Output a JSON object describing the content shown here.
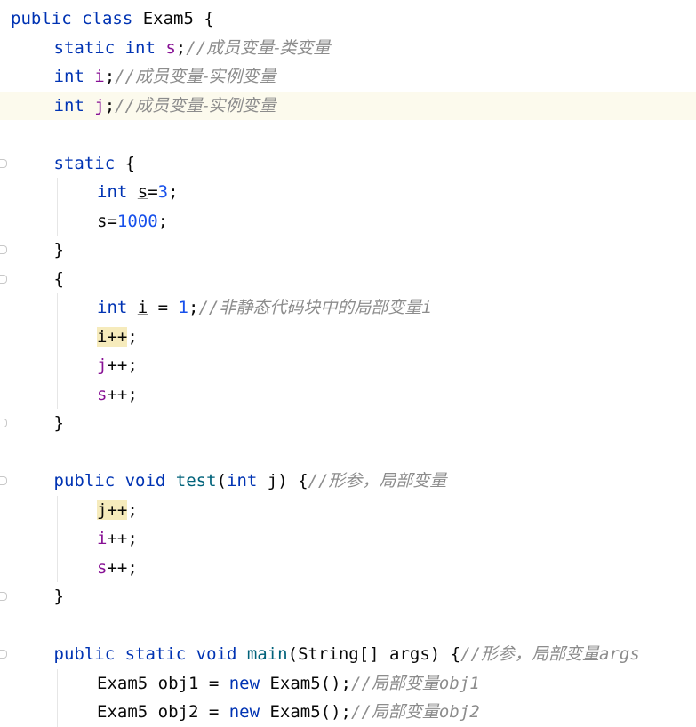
{
  "lines": [
    {
      "indent": 0,
      "tokens": [
        {
          "t": "public ",
          "c": "kw"
        },
        {
          "t": "class ",
          "c": "kw"
        },
        {
          "t": "Exam5 {",
          "c": "plain"
        }
      ]
    },
    {
      "indent": 1,
      "tokens": [
        {
          "t": "static ",
          "c": "kw"
        },
        {
          "t": "int ",
          "c": "kw"
        },
        {
          "t": "s",
          "c": "field"
        },
        {
          "t": ";",
          "c": "plain"
        },
        {
          "t": "//",
          "c": "cm-code"
        },
        {
          "t": "成员变量-类变量",
          "c": "cm"
        }
      ]
    },
    {
      "indent": 1,
      "tokens": [
        {
          "t": "int ",
          "c": "kw"
        },
        {
          "t": "i",
          "c": "field"
        },
        {
          "t": ";",
          "c": "plain"
        },
        {
          "t": "//",
          "c": "cm-code"
        },
        {
          "t": "成员变量-实例变量",
          "c": "cm"
        }
      ]
    },
    {
      "indent": 1,
      "current": true,
      "tokens": [
        {
          "t": "int ",
          "c": "kw"
        },
        {
          "t": "j",
          "c": "field"
        },
        {
          "t": ";",
          "c": "plain"
        },
        {
          "t": "//",
          "c": "cm-code"
        },
        {
          "t": "成员变量-实例变量",
          "c": "cm"
        }
      ]
    },
    {
      "indent": 0,
      "tokens": []
    },
    {
      "indent": 1,
      "tokens": [
        {
          "t": "static ",
          "c": "kw"
        },
        {
          "t": "{",
          "c": "plain"
        }
      ]
    },
    {
      "indent": 2,
      "tokens": [
        {
          "t": "int ",
          "c": "kw"
        },
        {
          "t": "s",
          "c": "plain ul"
        },
        {
          "t": "=",
          "c": "plain"
        },
        {
          "t": "3",
          "c": "num"
        },
        {
          "t": ";",
          "c": "plain"
        }
      ]
    },
    {
      "indent": 2,
      "tokens": [
        {
          "t": "s",
          "c": "plain ul"
        },
        {
          "t": "=",
          "c": "plain"
        },
        {
          "t": "1000",
          "c": "num"
        },
        {
          "t": ";",
          "c": "plain"
        }
      ]
    },
    {
      "indent": 1,
      "tokens": [
        {
          "t": "}",
          "c": "plain"
        }
      ]
    },
    {
      "indent": 1,
      "tokens": [
        {
          "t": "{",
          "c": "plain"
        }
      ]
    },
    {
      "indent": 2,
      "tokens": [
        {
          "t": "int ",
          "c": "kw"
        },
        {
          "t": "i",
          "c": "plain ul"
        },
        {
          "t": " = ",
          "c": "plain"
        },
        {
          "t": "1",
          "c": "num"
        },
        {
          "t": ";",
          "c": "plain"
        },
        {
          "t": "//",
          "c": "cm-code"
        },
        {
          "t": "非静态代码块中的局部变量",
          "c": "cm"
        },
        {
          "t": "i",
          "c": "cm-code"
        }
      ]
    },
    {
      "indent": 2,
      "tokens": [
        {
          "t": "i++",
          "c": "plain hl"
        },
        {
          "t": ";",
          "c": "plain"
        }
      ]
    },
    {
      "indent": 2,
      "tokens": [
        {
          "t": "j",
          "c": "field"
        },
        {
          "t": "++;",
          "c": "plain"
        }
      ]
    },
    {
      "indent": 2,
      "tokens": [
        {
          "t": "s",
          "c": "field"
        },
        {
          "t": "++;",
          "c": "plain"
        }
      ]
    },
    {
      "indent": 1,
      "tokens": [
        {
          "t": "}",
          "c": "plain"
        }
      ]
    },
    {
      "indent": 0,
      "tokens": []
    },
    {
      "indent": 1,
      "tokens": [
        {
          "t": "public ",
          "c": "kw"
        },
        {
          "t": "void ",
          "c": "kw"
        },
        {
          "t": "test",
          "c": "method"
        },
        {
          "t": "(",
          "c": "plain"
        },
        {
          "t": "int ",
          "c": "kw"
        },
        {
          "t": "j) {",
          "c": "plain"
        },
        {
          "t": "//",
          "c": "cm-code"
        },
        {
          "t": "形参，局部变量",
          "c": "cm"
        }
      ]
    },
    {
      "indent": 2,
      "tokens": [
        {
          "t": "j++",
          "c": "plain hl"
        },
        {
          "t": ";",
          "c": "plain"
        }
      ]
    },
    {
      "indent": 2,
      "tokens": [
        {
          "t": "i",
          "c": "field"
        },
        {
          "t": "++;",
          "c": "plain"
        }
      ]
    },
    {
      "indent": 2,
      "tokens": [
        {
          "t": "s",
          "c": "field"
        },
        {
          "t": "++;",
          "c": "plain"
        }
      ]
    },
    {
      "indent": 1,
      "tokens": [
        {
          "t": "}",
          "c": "plain"
        }
      ]
    },
    {
      "indent": 0,
      "tokens": []
    },
    {
      "indent": 1,
      "tokens": [
        {
          "t": "public ",
          "c": "kw"
        },
        {
          "t": "static ",
          "c": "kw"
        },
        {
          "t": "void ",
          "c": "kw"
        },
        {
          "t": "main",
          "c": "method"
        },
        {
          "t": "(String[] args) {",
          "c": "plain"
        },
        {
          "t": "//",
          "c": "cm-code"
        },
        {
          "t": "形参，局部变量",
          "c": "cm"
        },
        {
          "t": "args",
          "c": "cm-code"
        }
      ]
    },
    {
      "indent": 2,
      "tokens": [
        {
          "t": "Exam5 obj1 = ",
          "c": "plain"
        },
        {
          "t": "new ",
          "c": "kw"
        },
        {
          "t": "Exam5();",
          "c": "plain"
        },
        {
          "t": "//",
          "c": "cm-code"
        },
        {
          "t": "局部变量",
          "c": "cm"
        },
        {
          "t": "obj1",
          "c": "cm-code"
        }
      ]
    },
    {
      "indent": 2,
      "tokens": [
        {
          "t": "Exam5 obj2 = ",
          "c": "plain"
        },
        {
          "t": "new ",
          "c": "kw"
        },
        {
          "t": "Exam5();",
          "c": "plain"
        },
        {
          "t": "//",
          "c": "cm-code"
        },
        {
          "t": "局部变量",
          "c": "cm"
        },
        {
          "t": "obj2",
          "c": "cm-code"
        }
      ]
    }
  ]
}
